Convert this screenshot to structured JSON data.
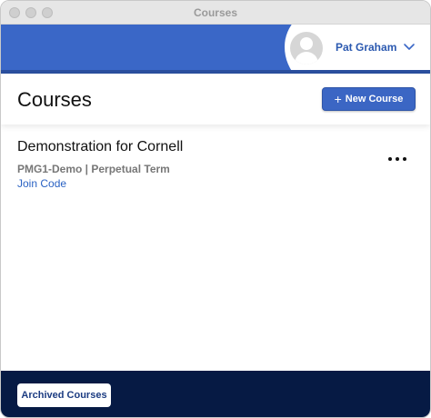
{
  "window": {
    "title": "Courses"
  },
  "user": {
    "name": "Pat Graham",
    "avatar_icon": "user-avatar-icon",
    "menu_icon": "chevron-down-icon"
  },
  "header": {
    "title": "Courses",
    "new_course_label": "New Course",
    "new_course_icon": "plus-icon"
  },
  "courses": [
    {
      "title": "Demonstration for Cornell",
      "meta": "PMG1-Demo | Perpetual Term",
      "join_code_label": "Join Code",
      "more_icon": "ellipsis-icon"
    }
  ],
  "footer": {
    "archived_label": "Archived Courses"
  },
  "colors": {
    "accent": "#3a67c7",
    "footer": "#061a44",
    "link": "#2a62c3"
  }
}
